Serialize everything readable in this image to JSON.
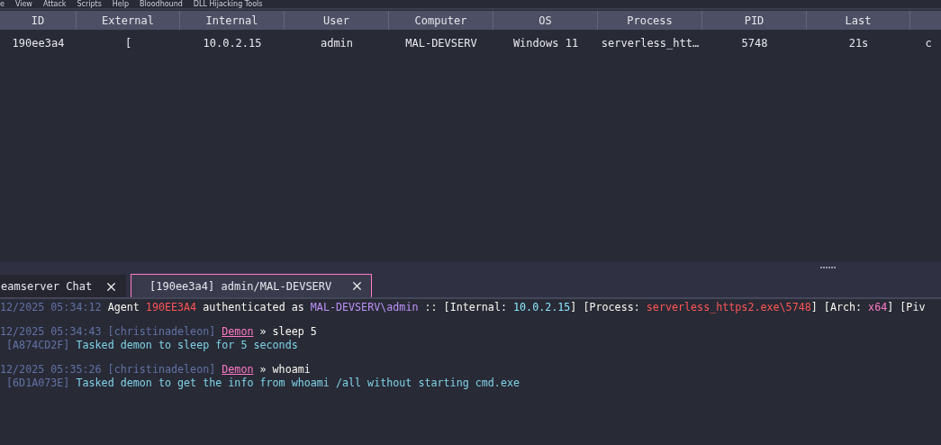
{
  "menu": [
    "e",
    "View",
    "Attack",
    "Scripts",
    "Help",
    "Bloodhound",
    "DLL Hijacking Tools"
  ],
  "table": {
    "columns": [
      "ID",
      "External",
      "Internal",
      "User",
      "Computer",
      "OS",
      "Process",
      "PID",
      "Last"
    ],
    "rows": [
      {
        "selected": false,
        "cells": [
          "190ee3a4",
          "[",
          "10.0.2.15",
          "admin",
          "MAL-DEVSERV",
          "Windows 11",
          "serverless_htt…",
          "5748",
          "21s",
          "c"
        ]
      }
    ]
  },
  "tabs": [
    {
      "label": "eamserver Chat",
      "selected": false
    },
    {
      "label": "[190ee3a4] admin/MAL-DEVSERV",
      "selected": true
    }
  ],
  "log": [
    {
      "lines": [
        [
          {
            "kind": "time",
            "text": "12/2025 05:34:12"
          },
          {
            "kind": "plain",
            "text": " Agent "
          },
          {
            "kind": "agent",
            "text": "190EE3A4"
          },
          {
            "kind": "plain",
            "text": " authenticated as "
          },
          {
            "kind": "host",
            "text": "MAL-DEVSERV\\admin"
          },
          {
            "kind": "plain",
            "text": " :: [Internal: "
          },
          {
            "kind": "ip",
            "text": "10.0.2.15"
          },
          {
            "kind": "plain",
            "text": "] [Process: "
          },
          {
            "kind": "process",
            "text": "serverless_https2.exe\\5748"
          },
          {
            "kind": "plain",
            "text": "] [Arch: "
          },
          {
            "kind": "arch",
            "text": "x64"
          },
          {
            "kind": "plain",
            "text": "] [Piv"
          }
        ]
      ]
    },
    {
      "lines": [
        [
          {
            "kind": "time",
            "text": "12/2025 05:34:43 [christinadeleon] "
          },
          {
            "kind": "link",
            "text": "Demon"
          },
          {
            "kind": "plain",
            "text": " » sleep 5"
          }
        ],
        [
          {
            "kind": "time",
            "text": " [A874CD2F]"
          },
          {
            "kind": "task",
            "text": " Tasked demon to sleep for 5 seconds"
          }
        ]
      ]
    },
    {
      "lines": [
        [
          {
            "kind": "time",
            "text": "12/2025 05:35:26 [christinadeleon] "
          },
          {
            "kind": "link",
            "text": "Demon"
          },
          {
            "kind": "plain",
            "text": " » whoami"
          }
        ],
        [
          {
            "kind": "time",
            "text": " [6D1A073E]"
          },
          {
            "kind": "task",
            "text": " Tasked demon to get the info from whoami /all without starting cmd.exe"
          }
        ]
      ]
    }
  ]
}
